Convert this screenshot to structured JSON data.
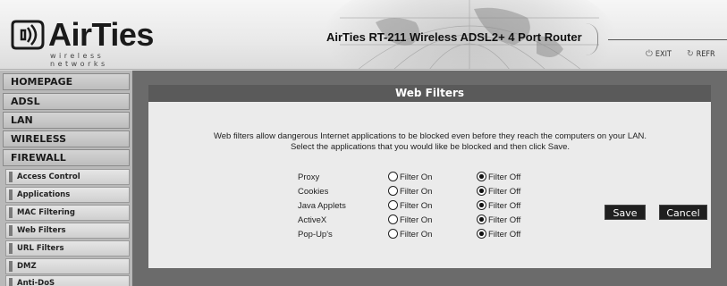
{
  "header": {
    "logo_text": "AirTies",
    "logo_tagline": "wireless networks",
    "router_title": "AirTies RT-211 Wireless ADSL2+ 4 Port Router",
    "links": [
      {
        "label": "EXIT",
        "icon": "power-icon"
      },
      {
        "label": "REFR",
        "icon": "refresh-icon"
      }
    ]
  },
  "sidebar": {
    "menu": [
      {
        "label": "HOMEPAGE"
      },
      {
        "label": "ADSL"
      },
      {
        "label": "LAN"
      },
      {
        "label": "WIRELESS"
      },
      {
        "label": "FIREWALL"
      }
    ],
    "submenu": [
      {
        "label": "Access Control"
      },
      {
        "label": "Applications"
      },
      {
        "label": "MAC Filtering"
      },
      {
        "label": "Web Filters"
      },
      {
        "label": "URL Filters"
      },
      {
        "label": "DMZ"
      },
      {
        "label": "Anti-DoS"
      }
    ]
  },
  "panel": {
    "title": "Web Filters",
    "description_line1": "Web filters allow dangerous Internet applications to be blocked even before they reach the computers on your LAN.",
    "description_line2": "Select the applications that you would like be blocked and then click Save.",
    "on_label": "Filter On",
    "off_label": "Filter Off",
    "filters": [
      {
        "name": "Proxy",
        "value": "off"
      },
      {
        "name": "Cookies",
        "value": "off"
      },
      {
        "name": "Java Applets",
        "value": "off"
      },
      {
        "name": "ActiveX",
        "value": "off"
      },
      {
        "name": "Pop-Up's",
        "value": "off"
      }
    ]
  },
  "buttons": {
    "save": "Save",
    "cancel": "Cancel"
  }
}
